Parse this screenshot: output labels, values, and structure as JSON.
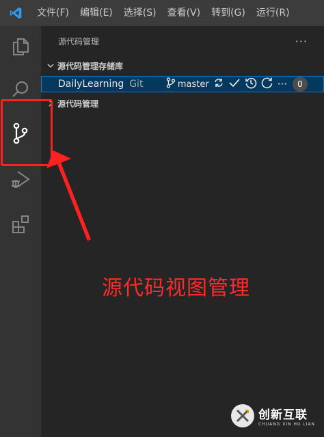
{
  "menubar": {
    "app_icon": "vscode-logo-icon",
    "items": [
      "文件(F)",
      "编辑(E)",
      "选择(S)",
      "查看(V)",
      "转到(G)",
      "运行(R)"
    ]
  },
  "activitybar": {
    "items": [
      {
        "name": "explorer",
        "icon": "files-icon"
      },
      {
        "name": "search",
        "icon": "search-icon"
      },
      {
        "name": "source-control",
        "icon": "source-control-icon",
        "active": true
      },
      {
        "name": "run-debug",
        "icon": "run-debug-icon"
      },
      {
        "name": "extensions",
        "icon": "extensions-icon"
      }
    ]
  },
  "sidebar": {
    "title": "源代码管理",
    "more": "···",
    "repos_section": "源代码管理存储库",
    "repo": {
      "name": "DailyLearning",
      "type": "Git",
      "branch": "master",
      "badge": "0"
    },
    "scm_section": "源代码管理"
  },
  "annotation": {
    "text": "源代码视图管理",
    "color": "#ff2a2a"
  },
  "watermark": {
    "main": "创新互联",
    "sub": "CHUANG XIN HU LIAN"
  },
  "colors": {
    "accent": "#007acc",
    "selection": "#04395e",
    "annotation": "#ff2020"
  }
}
